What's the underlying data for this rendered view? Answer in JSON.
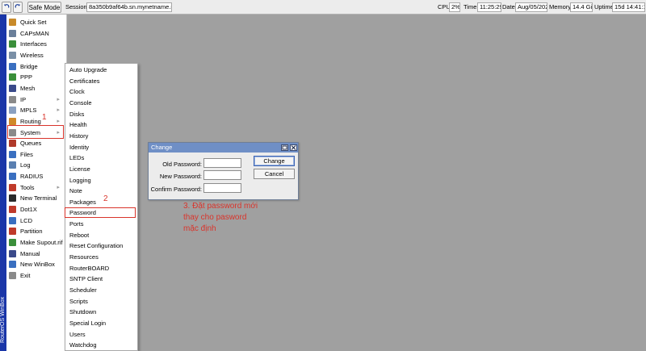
{
  "toolbar": {
    "back_icon": "undo-icon",
    "forward_icon": "redo-icon",
    "safe_mode_label": "Safe Mode",
    "session_label": "Session:",
    "session_value": "8a350b9af64b.sn.mynetname.net",
    "cpu_label": "CPU:",
    "cpu_value": "2%",
    "time_label": "Time:",
    "time_value": "11:25:29",
    "date_label": "Date:",
    "date_value": "Aug/05/2021",
    "memory_label": "Memory:",
    "memory_value": "14.4 GiB",
    "uptime_label": "Uptime:",
    "uptime_value": "15d 14:41:17"
  },
  "brand": {
    "vertical_text": "RouterOS WinBox"
  },
  "left_menu": [
    {
      "label": "Quick Set",
      "icon": "quick-set-icon",
      "color": "#c88a2a",
      "submenu": false
    },
    {
      "label": "CAPsMAN",
      "icon": "capsman-icon",
      "color": "#6a7f9a",
      "submenu": false
    },
    {
      "label": "Interfaces",
      "icon": "interfaces-icon",
      "color": "#3a8f3a",
      "submenu": false
    },
    {
      "label": "Wireless",
      "icon": "wireless-icon",
      "color": "#7a8fa6",
      "submenu": false
    },
    {
      "label": "Bridge",
      "icon": "bridge-icon",
      "color": "#3a6fc0",
      "submenu": false
    },
    {
      "label": "PPP",
      "icon": "ppp-icon",
      "color": "#3a8f3a",
      "submenu": false
    },
    {
      "label": "Mesh",
      "icon": "mesh-icon",
      "color": "#3a4a8a",
      "submenu": false
    },
    {
      "label": "IP",
      "icon": "ip-icon",
      "color": "#8a8a8a",
      "submenu": true
    },
    {
      "label": "MPLS",
      "icon": "mpls-icon",
      "color": "#8aa0c0",
      "submenu": true
    },
    {
      "label": "Routing",
      "icon": "routing-icon",
      "color": "#d08a2a",
      "submenu": true
    },
    {
      "label": "System",
      "icon": "system-icon",
      "color": "#8a8a8a",
      "submenu": true
    },
    {
      "label": "Queues",
      "icon": "queues-icon",
      "color": "#b03a2a",
      "submenu": false
    },
    {
      "label": "Files",
      "icon": "files-icon",
      "color": "#3a6fc0",
      "submenu": false
    },
    {
      "label": "Log",
      "icon": "log-icon",
      "color": "#5a7fb0",
      "submenu": false
    },
    {
      "label": "RADIUS",
      "icon": "radius-icon",
      "color": "#3a6fc0",
      "submenu": false
    },
    {
      "label": "Tools",
      "icon": "tools-icon",
      "color": "#c03a2a",
      "submenu": true
    },
    {
      "label": "New Terminal",
      "icon": "terminal-icon",
      "color": "#2a2a2a",
      "submenu": false
    },
    {
      "label": "Dot1X",
      "icon": "dot1x-icon",
      "color": "#c03a2a",
      "submenu": false
    },
    {
      "label": "LCD",
      "icon": "lcd-icon",
      "color": "#3a6fc0",
      "submenu": false
    },
    {
      "label": "Partition",
      "icon": "partition-icon",
      "color": "#c03a2a",
      "submenu": false
    },
    {
      "label": "Make Supout.rif",
      "icon": "supout-icon",
      "color": "#3a8f3a",
      "submenu": false
    },
    {
      "label": "Manual",
      "icon": "manual-icon",
      "color": "#3a4a8a",
      "submenu": false
    },
    {
      "label": "New WinBox",
      "icon": "winbox-icon",
      "color": "#3a6fc0",
      "submenu": false
    },
    {
      "label": "Exit",
      "icon": "exit-icon",
      "color": "#8a8a8a",
      "submenu": false
    }
  ],
  "system_submenu": [
    "Auto Upgrade",
    "Certificates",
    "Clock",
    "Console",
    "Disks",
    "Health",
    "History",
    "Identity",
    "LEDs",
    "License",
    "Logging",
    "Note",
    "Packages",
    "Password",
    "Ports",
    "Reboot",
    "Reset Configuration",
    "Resources",
    "RouterBOARD",
    "SNTP Client",
    "Scheduler",
    "Scripts",
    "Shutdown",
    "Special Login",
    "Users",
    "Watchdog"
  ],
  "annotations": {
    "step1": "1",
    "step2": "2",
    "step3_line1": "3. Đặt password mới",
    "step3_line2": "thay cho pasword",
    "step3_line3": "mặc định",
    "color": "#d9342b"
  },
  "dialog": {
    "title": "Change",
    "old_password_label": "Old Password:",
    "new_password_label": "New Password:",
    "confirm_password_label": "Confirm Password:",
    "old_password_value": "",
    "new_password_value": "",
    "confirm_password_value": "",
    "change_button": "Change",
    "cancel_button": "Cancel"
  }
}
